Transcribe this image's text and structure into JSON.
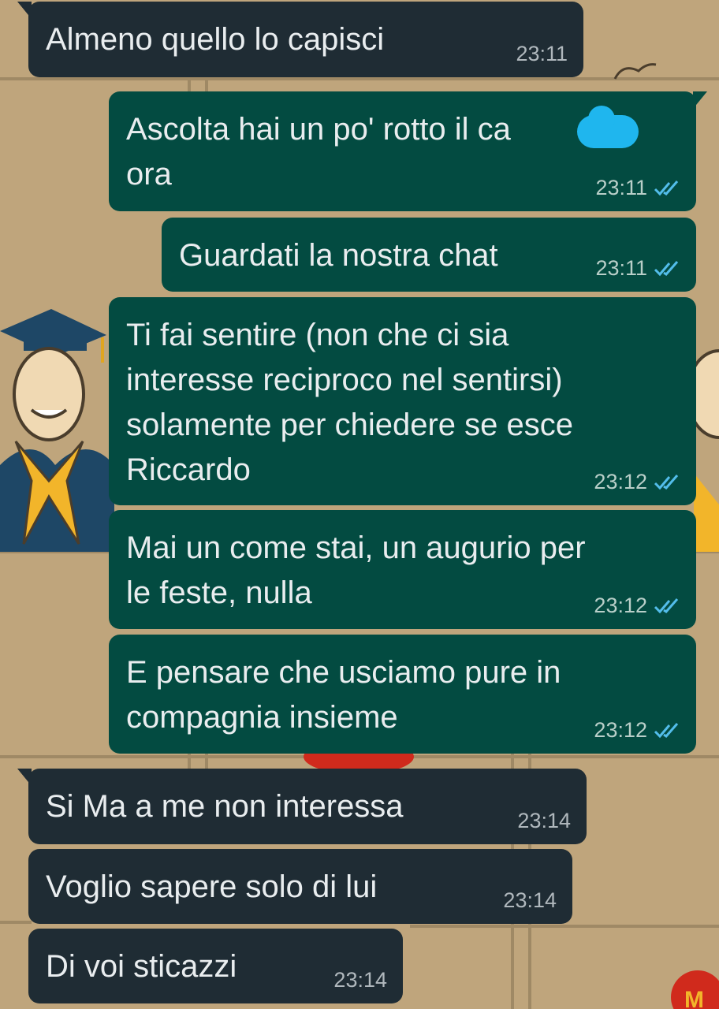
{
  "colors": {
    "wallpaper": "#bfa57c",
    "incoming_bubble": "#1f2c34",
    "outgoing_bubble": "#034b41",
    "read_ticks": "#53bdeb"
  },
  "messages": [
    {
      "direction": "incoming",
      "text": "Almeno quello lo capisci",
      "time": "23:11"
    },
    {
      "direction": "outgoing",
      "text": "Ascolta hai un po' rotto il ca         o\nora",
      "time": "23:11",
      "status_icon": "double-check-read-icon"
    },
    {
      "direction": "outgoing",
      "text": "Guardati la nostra chat",
      "time": "23:11",
      "status_icon": "double-check-read-icon"
    },
    {
      "direction": "outgoing",
      "text": "Ti fai sentire (non che ci sia\ninteresse reciproco nel sentirsi)\nsolamente per chiedere se esce\nRiccardo",
      "time": "23:12",
      "status_icon": "double-check-read-icon"
    },
    {
      "direction": "outgoing",
      "text": "Mai un come stai, un augurio per\nle feste, nulla",
      "time": "23:12",
      "status_icon": "double-check-read-icon"
    },
    {
      "direction": "outgoing",
      "text": "E pensare che usciamo pure in\ncompagnia insieme",
      "time": "23:12",
      "status_icon": "double-check-read-icon"
    },
    {
      "direction": "incoming",
      "text": "Si Ma a me non interessa",
      "time": "23:14"
    },
    {
      "direction": "incoming",
      "text": "Voglio sapere solo di lui",
      "time": "23:14"
    },
    {
      "direction": "incoming",
      "text": "Di voi sticazzi",
      "time": "23:14"
    }
  ]
}
